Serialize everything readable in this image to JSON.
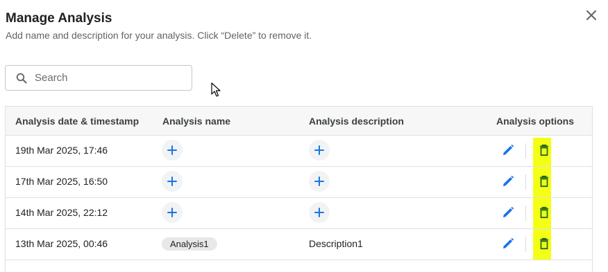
{
  "dialog": {
    "title": "Manage Analysis",
    "subtitle": "Add name and description for your analysis. Click “Delete” to remove it.",
    "close_icon": "close-icon"
  },
  "search": {
    "placeholder": "Search",
    "value": ""
  },
  "table": {
    "headers": {
      "timestamp": "Analysis date & timestamp",
      "name": "Analysis name",
      "description": "Analysis description",
      "options": "Analysis options"
    },
    "rows": [
      {
        "timestamp": "19th Mar 2025, 17:46",
        "name": "",
        "description": ""
      },
      {
        "timestamp": "17th Mar 2025, 16:50",
        "name": "",
        "description": ""
      },
      {
        "timestamp": "14th Mar 2025, 22:12",
        "name": "",
        "description": ""
      },
      {
        "timestamp": "13th Mar 2025, 00:46",
        "name": "Analysis1",
        "description": "Description1"
      }
    ]
  },
  "colors": {
    "accent": "#1a73e8",
    "highlight": "#f5ff16",
    "delete_icon": "#1f6b1f"
  }
}
